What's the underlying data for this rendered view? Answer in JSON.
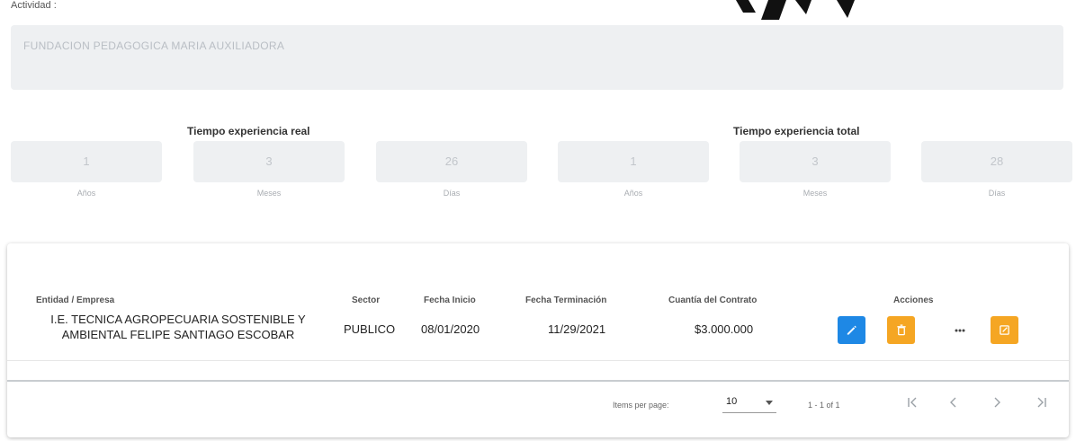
{
  "form": {
    "field_label": "Actividad :",
    "institution_value": "FUNDACION PEDAGOGICA MARIA AUXILIADORA"
  },
  "experience": {
    "real": {
      "title": "Tiempo experiencia real",
      "anos": "1",
      "meses": "3",
      "dias": "26",
      "anos_label": "Años",
      "meses_label": "Meses",
      "dias_label": "Días"
    },
    "total": {
      "title": "Tiempo experiencia total",
      "anos": "1",
      "meses": "3",
      "dias": "28",
      "anos_label": "Años",
      "meses_label": "Meses",
      "dias_label": "Días"
    }
  },
  "table": {
    "headers": {
      "entity": "Entidad / Empresa",
      "sector": "Sector",
      "start": "Fecha Inicio",
      "end": "Fecha Terminación",
      "amount": "Cuantía del Contrato",
      "actions": "Acciones"
    },
    "rows": [
      {
        "entity_line1": "I.E. TECNICA AGROPECUARIA SOSTENIBLE Y",
        "entity_line2": "AMBIENTAL FELIPE SANTIAGO ESCOBAR",
        "sector": "PUBLICO",
        "start": "08/01/2020",
        "end": "11/29/2021",
        "amount": "$3.000.000"
      }
    ]
  },
  "pagination": {
    "items_per_page_label": "Items per page:",
    "items_per_page_value": "10",
    "range": "1 - 1 of 1"
  },
  "icons": {
    "edit": "pencil-icon",
    "delete": "trash-icon",
    "more": "more-horizontal-icon",
    "document": "document-icon",
    "first": "first-page-icon",
    "prev": "chevron-left-icon",
    "next": "chevron-right-icon",
    "last": "last-page-icon"
  },
  "colors": {
    "edit_button": "#1e88e5",
    "action_button": "#f5a623",
    "field_background": "#eef0f2"
  }
}
